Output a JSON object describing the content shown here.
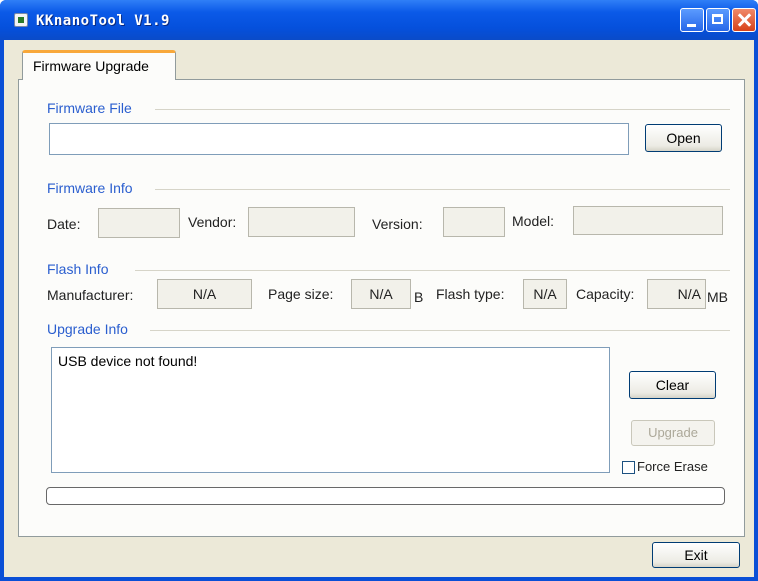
{
  "window": {
    "title": "KKnanoTool V1.9"
  },
  "tabs": [
    {
      "label": "Firmware Upgrade"
    }
  ],
  "firmware_file": {
    "group_label": "Firmware File",
    "path_value": "",
    "open_label": "Open"
  },
  "firmware_info": {
    "group_label": "Firmware Info",
    "date_label": "Date:",
    "date_value": "",
    "vendor_label": "Vendor:",
    "vendor_value": "",
    "version_label": "Version:",
    "version_value": "",
    "model_label": "Model:",
    "model_value": ""
  },
  "flash_info": {
    "group_label": "Flash Info",
    "manufacturer_label": "Manufacturer:",
    "manufacturer_value": "N/A",
    "page_size_label": "Page size:",
    "page_size_value": "N/A",
    "page_size_unit": "B",
    "flash_type_label": "Flash type:",
    "flash_type_value": "N/A",
    "capacity_label": "Capacity:",
    "capacity_value": "N/A",
    "capacity_unit": "MB"
  },
  "upgrade_info": {
    "group_label": "Upgrade Info",
    "log_text": "USB device not found!",
    "clear_label": "Clear",
    "upgrade_label": "Upgrade",
    "force_erase_label": "Force Erase",
    "force_erase_checked": false,
    "progress": 0
  },
  "footer": {
    "exit_label": "Exit"
  }
}
